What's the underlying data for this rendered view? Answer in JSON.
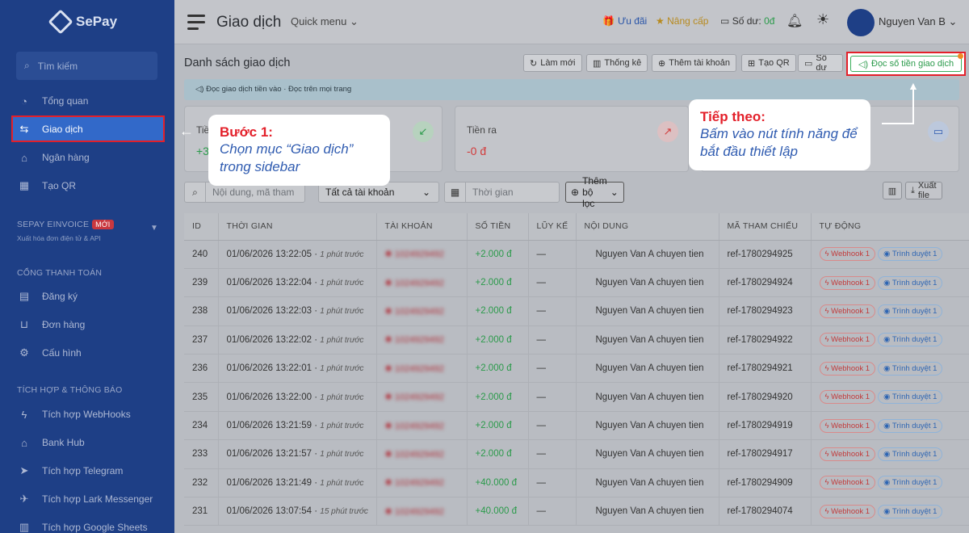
{
  "sidebar": {
    "logo": "SePay",
    "search_placeholder": "Tìm kiếm",
    "items": [
      {
        "label": "Tổng quan",
        "icon": "dashboard-icon"
      },
      {
        "label": "Giao dịch",
        "icon": "transfer-icon"
      },
      {
        "label": "Ngân hàng",
        "icon": "bank-icon"
      },
      {
        "label": "Tạo QR",
        "icon": "qr-icon"
      }
    ],
    "einvoice": {
      "title": "SEPAY EINVOICE",
      "badge": "MỚI",
      "desc": "Xuất hóa đơn điện tử & API"
    },
    "payment_section": "CỔNG THANH TOÁN",
    "payment_items": [
      {
        "label": "Đăng ký",
        "icon": "register-icon"
      },
      {
        "label": "Đơn hàng",
        "icon": "cart-icon"
      },
      {
        "label": "Cấu hình",
        "icon": "gear-icon"
      }
    ],
    "integration_section": "TÍCH HỢP & THÔNG BÁO",
    "integration_items": [
      {
        "label": "Tích hợp WebHooks",
        "icon": "webhook-icon"
      },
      {
        "label": "Bank Hub",
        "icon": "bankhub-icon"
      },
      {
        "label": "Tích hợp Telegram",
        "icon": "telegram-icon"
      },
      {
        "label": "Tích hợp Lark Messenger",
        "icon": "lark-icon"
      },
      {
        "label": "Tích hợp Google Sheets",
        "icon": "sheets-icon"
      }
    ]
  },
  "header": {
    "title": "Giao dịch",
    "quick_menu": "Quick menu",
    "promo": "Ưu đãi",
    "upgrade": "Nâng cấp",
    "balance_label": "Số dư:",
    "balance_value": "0đ",
    "username": "Nguyen Van B"
  },
  "main": {
    "list_title": "Danh sách giao dịch",
    "toolbar": {
      "refresh": "Làm mới",
      "stats": "Thống kê",
      "add_account": "Thêm tài khoản",
      "create_qr": "Tạo QR",
      "balance": "Số dư",
      "read_amount": "Đọc số tiền giao dịch"
    },
    "info_strip": "Đọc giao dịch tiền vào · Đọc trên mọi trang",
    "stats": {
      "in_label": "Tiề",
      "in_value": "+3",
      "out_label": "Tiền ra",
      "out_value": "-0 đ"
    },
    "filters": {
      "search_placeholder": "Nội dung, mã tham",
      "account_select": "Tất cả tài khoản",
      "time_placeholder": "Thời gian",
      "add_filter": "Thêm bộ lọc",
      "export": "Xuất file"
    },
    "table": {
      "headers": [
        "ID",
        "THỜI GIAN",
        "TÀI KHOẢN",
        "SỐ TIỀN",
        "LŨY KẾ",
        "NỘI DUNG",
        "MÃ THAM CHIẾU",
        "TỰ ĐỘNG"
      ],
      "rows": [
        {
          "id": "240",
          "time": "01/06/2026 13:22:05",
          "ago": "1 phút trước",
          "account": "1024929492",
          "amount": "+2.000 đ",
          "cumulative": "—",
          "content": "Nguyen Van A  chuyen tien",
          "ref": "ref-1780294925",
          "webhook": "Webhook 1",
          "browser": "Trình duyệt 1"
        },
        {
          "id": "239",
          "time": "01/06/2026 13:22:04",
          "ago": "1 phút trước",
          "account": "1024929492",
          "amount": "+2.000 đ",
          "cumulative": "—",
          "content": "Nguyen Van A  chuyen tien",
          "ref": "ref-1780294924",
          "webhook": "Webhook 1",
          "browser": "Trình duyệt 1"
        },
        {
          "id": "238",
          "time": "01/06/2026 13:22:03",
          "ago": "1 phút trước",
          "account": "1024929492",
          "amount": "+2.000 đ",
          "cumulative": "—",
          "content": "Nguyen Van A  chuyen tien",
          "ref": "ref-1780294923",
          "webhook": "Webhook 1",
          "browser": "Trình duyệt 1"
        },
        {
          "id": "237",
          "time": "01/06/2026 13:22:02",
          "ago": "1 phút trước",
          "account": "1024929492",
          "amount": "+2.000 đ",
          "cumulative": "—",
          "content": "Nguyen Van A  chuyen tien",
          "ref": "ref-1780294922",
          "webhook": "Webhook 1",
          "browser": "Trình duyệt 1"
        },
        {
          "id": "236",
          "time": "01/06/2026 13:22:01",
          "ago": "1 phút trước",
          "account": "1024929492",
          "amount": "+2.000 đ",
          "cumulative": "—",
          "content": "Nguyen Van A  chuyen tien",
          "ref": "ref-1780294921",
          "webhook": "Webhook 1",
          "browser": "Trình duyệt 1"
        },
        {
          "id": "235",
          "time": "01/06/2026 13:22:00",
          "ago": "1 phút trước",
          "account": "1024929492",
          "amount": "+2.000 đ",
          "cumulative": "—",
          "content": "Nguyen Van A  chuyen tien",
          "ref": "ref-1780294920",
          "webhook": "Webhook 1",
          "browser": "Trình duyệt 1"
        },
        {
          "id": "234",
          "time": "01/06/2026 13:21:59",
          "ago": "1 phút trước",
          "account": "1024929492",
          "amount": "+2.000 đ",
          "cumulative": "—",
          "content": "Nguyen Van A  chuyen tien",
          "ref": "ref-1780294919",
          "webhook": "Webhook 1",
          "browser": "Trình duyệt 1"
        },
        {
          "id": "233",
          "time": "01/06/2026 13:21:57",
          "ago": "1 phút trước",
          "account": "1024929492",
          "amount": "+2.000 đ",
          "cumulative": "—",
          "content": "Nguyen Van A  chuyen tien",
          "ref": "ref-1780294917",
          "webhook": "Webhook 1",
          "browser": "Trình duyệt 1"
        },
        {
          "id": "232",
          "time": "01/06/2026 13:21:49",
          "ago": "1 phút trước",
          "account": "1024929492",
          "amount": "+40.000 đ",
          "cumulative": "—",
          "content": "Nguyen Van A  chuyen tien",
          "ref": "ref-1780294909",
          "webhook": "Webhook 1",
          "browser": "Trình duyệt 1"
        },
        {
          "id": "231",
          "time": "01/06/2026 13:07:54",
          "ago": "15 phút trước",
          "account": "1024929492",
          "amount": "+40.000 đ",
          "cumulative": "—",
          "content": "Nguyen Van A  chuyen tien",
          "ref": "ref-1780294074",
          "webhook": "Webhook 1",
          "browser": "Trình duyệt 1"
        }
      ]
    }
  },
  "callouts": {
    "step1_title": "Bước 1:",
    "step1_body": "Chọn mục “Giao dịch” trong sidebar",
    "next_title": "Tiếp theo:",
    "next_body": "Bấm vào nút tính năng để bắt đầu thiết lập"
  },
  "colors": {
    "sidebar_bg": "#1e3f86",
    "active_bg": "#3269c9",
    "highlight_red": "#e3202a",
    "positive_green": "#2a9a4a"
  }
}
